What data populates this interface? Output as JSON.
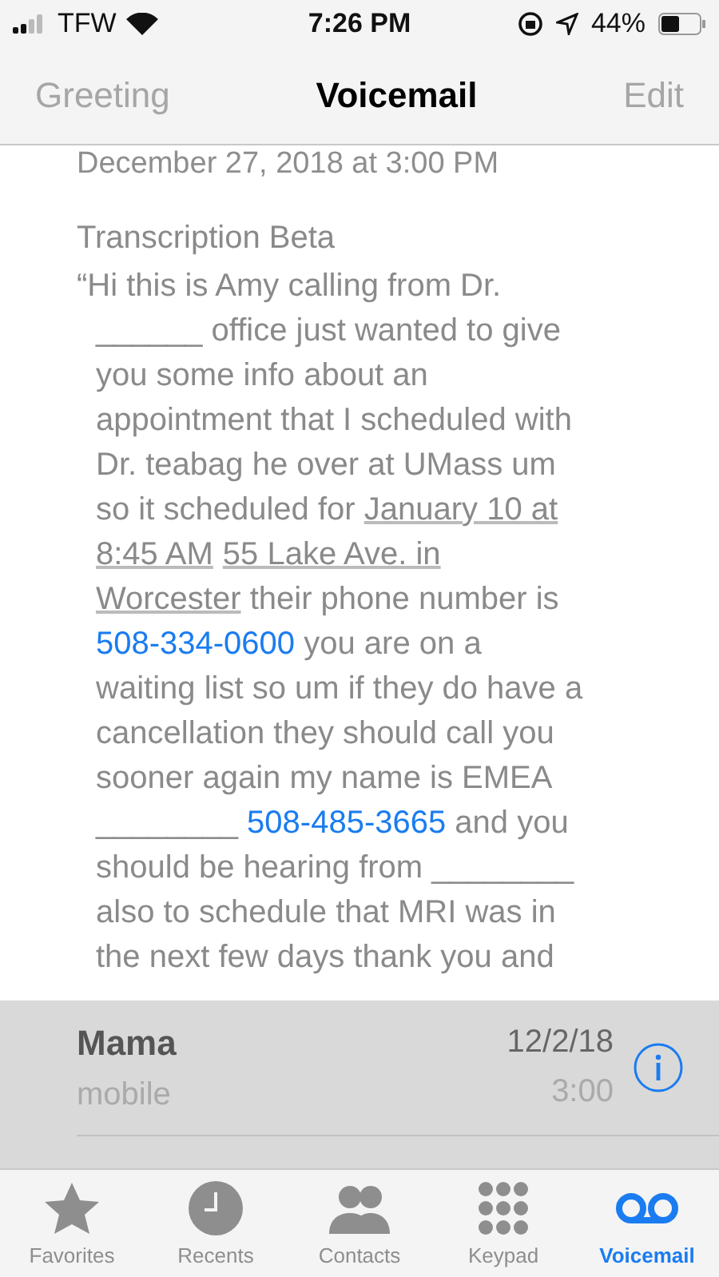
{
  "status_bar": {
    "carrier": "TFW",
    "time": "7:26 PM",
    "battery": "44%"
  },
  "nav": {
    "left": "Greeting",
    "title": "Voicemail",
    "right": "Edit"
  },
  "message": {
    "date": "December 27, 2018 at 3:00 PM",
    "heading": "Transcription Beta",
    "lines": [
      [
        {
          "kind": "text",
          "text": "“Hi this is Amy calling from Dr."
        }
      ],
      [
        {
          "kind": "text",
          "text": "______ office just wanted to give"
        }
      ],
      [
        {
          "kind": "text",
          "text": "you some info about an"
        }
      ],
      [
        {
          "kind": "text",
          "text": "appointment that I scheduled with"
        }
      ],
      [
        {
          "kind": "text",
          "text": "Dr. teabag he over at UMass um"
        }
      ],
      [
        {
          "kind": "text",
          "text": "so it scheduled for "
        },
        {
          "kind": "date",
          "text": "January 10 at"
        }
      ],
      [
        {
          "kind": "date",
          "text": "8:45 AM"
        },
        {
          "kind": "address",
          "text": "55 Lake Ave. in"
        }
      ],
      [
        {
          "kind": "address",
          "text": "Worcester"
        },
        {
          "kind": "text",
          "text": " their phone number is"
        }
      ],
      [
        {
          "kind": "phone",
          "text": "508-334-0600"
        },
        {
          "kind": "text",
          "text": " you are on a"
        }
      ],
      [
        {
          "kind": "text",
          "text": "waiting list so um if they do have a"
        }
      ],
      [
        {
          "kind": "text",
          "text": "cancellation they should call you"
        }
      ],
      [
        {
          "kind": "text",
          "text": "sooner again my name is EMEA"
        }
      ],
      [
        {
          "kind": "text",
          "text": "________ "
        },
        {
          "kind": "phone",
          "text": "508-485-3665"
        },
        {
          "kind": "text",
          "text": " and you"
        }
      ],
      [
        {
          "kind": "text",
          "text": "should be hearing from ________"
        }
      ],
      [
        {
          "kind": "text",
          "text": "also to schedule that MRI was in"
        }
      ],
      [
        {
          "kind": "text",
          "text": "the next few days thank you and"
        }
      ]
    ]
  },
  "voicemails": [
    {
      "name": "Mama",
      "label": "mobile",
      "date": "12/2/18",
      "duration": "3:00"
    }
  ],
  "tabs": [
    {
      "label": "Favorites",
      "kind": "star",
      "selected": false
    },
    {
      "label": "Recents",
      "kind": "clock",
      "selected": false
    },
    {
      "label": "Contacts",
      "kind": "people",
      "selected": false
    },
    {
      "label": "Keypad",
      "kind": "keypad",
      "selected": false
    },
    {
      "label": "Voicemail",
      "kind": "voicemail",
      "selected": true
    }
  ]
}
